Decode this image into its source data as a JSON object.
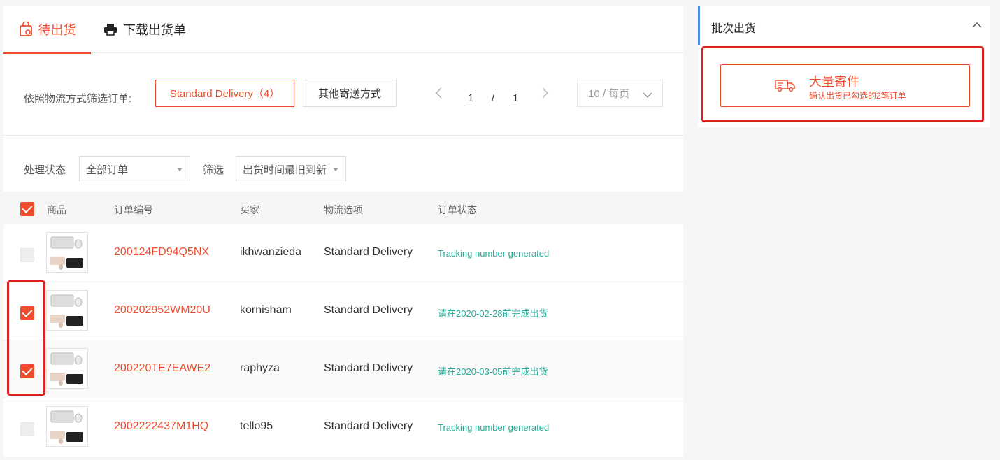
{
  "tabs": [
    {
      "label": "待出货",
      "icon": "package-icon",
      "active": true
    },
    {
      "label": "下载出货单",
      "icon": "printer-icon",
      "active": false
    }
  ],
  "filter": {
    "label": "依照物流方式筛选订单:",
    "standard_button": "Standard Delivery（4）",
    "other_button": "其他寄送方式"
  },
  "pager": {
    "current": "1",
    "separator": "/",
    "total": "1",
    "page_size": "10 / 每页"
  },
  "status_filter": {
    "label": "处理状态",
    "value": "全部订单",
    "sort_label": "筛选",
    "sort_value": "出货时间最旧到新"
  },
  "table": {
    "headers": [
      "商品",
      "订单编号",
      "买家",
      "物流选项",
      "订单状态"
    ],
    "header_checked": true,
    "rows": [
      {
        "order_id": "200124FD94Q5NX",
        "buyer": "ikhwanzieda",
        "shipping": "Standard Delivery",
        "status": "Tracking number generated",
        "checked": false
      },
      {
        "order_id": "200202952WM20U",
        "buyer": "kornisham",
        "shipping": "Standard Delivery",
        "status": "请在2020-02-28前完成出货",
        "checked": true
      },
      {
        "order_id": "200220TE7EAWE2",
        "buyer": "raphyza",
        "shipping": "Standard Delivery",
        "status": "请在2020-03-05前完成出货",
        "checked": true
      },
      {
        "order_id": "2002222437M1HQ",
        "buyer": "tello95",
        "shipping": "Standard Delivery",
        "status": "Tracking number generated",
        "checked": false
      }
    ]
  },
  "side_panel": {
    "title": "批次出货",
    "bulk_button_title": "大量寄件",
    "bulk_button_subtitle": "确认出货已勾选的2笔订单"
  },
  "colors": {
    "accent": "#ee4d2d",
    "status_green": "#26aa99",
    "highlight_red": "#e02020",
    "side_border_blue": "#4a90e2"
  }
}
